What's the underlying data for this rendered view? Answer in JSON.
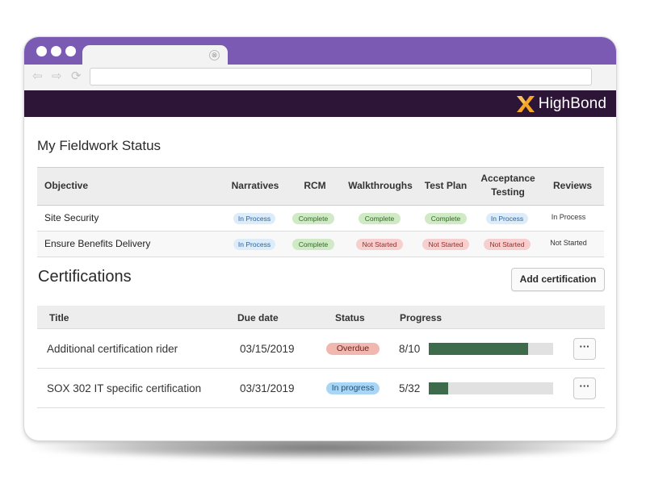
{
  "colors": {
    "titlebar": "#7a5ab2",
    "app_header": "#2d1537",
    "logo_accent": "#f5a623",
    "progress_fill": "#3d6b4b",
    "progress_track": "#e1e1e1"
  },
  "browser": {
    "nav_icons": [
      "back-arrow-icon",
      "forward-arrow-icon",
      "reload-icon"
    ],
    "tab_close": "⊗"
  },
  "header": {
    "logo_text": "HighBond",
    "logo_icon": "highbond-x-icon"
  },
  "fieldwork": {
    "title": "My Fieldwork Status",
    "columns": {
      "objective": "Objective",
      "narratives": "Narratives",
      "rcm": "RCM",
      "walkthroughs": "Walkthroughs",
      "test_plan": "Test Plan",
      "acceptance_1": "Acceptance",
      "acceptance_2": "Testing",
      "reviews": "Reviews"
    },
    "rows": [
      {
        "objective": "Site Security",
        "narratives": "In Process",
        "rcm": "Complete",
        "walkthroughs": "Complete",
        "test_plan": "Complete",
        "acceptance": "In Process",
        "reviews": "In Process"
      },
      {
        "objective": "Ensure Benefits Delivery",
        "narratives": "In Process",
        "rcm": "Complete",
        "walkthroughs": "Not Started",
        "test_plan": "Not Started",
        "acceptance": "Not Started",
        "reviews": "Not Started"
      }
    ]
  },
  "certifications": {
    "title": "Certifications",
    "add_button": "Add certification",
    "columns": {
      "title": "Title",
      "due_date": "Due date",
      "status": "Status",
      "progress": "Progress"
    },
    "rows": [
      {
        "title": "Additional certification rider",
        "due_date": "03/15/2019",
        "status": "Overdue",
        "progress_label": "8/10",
        "progress_fraction": 0.8,
        "more": "···"
      },
      {
        "title": "SOX 302 IT specific certification",
        "due_date": "03/31/2019",
        "status": "In progress",
        "progress_label": "5/32",
        "progress_fraction": 0.15625,
        "more": "···"
      }
    ]
  }
}
